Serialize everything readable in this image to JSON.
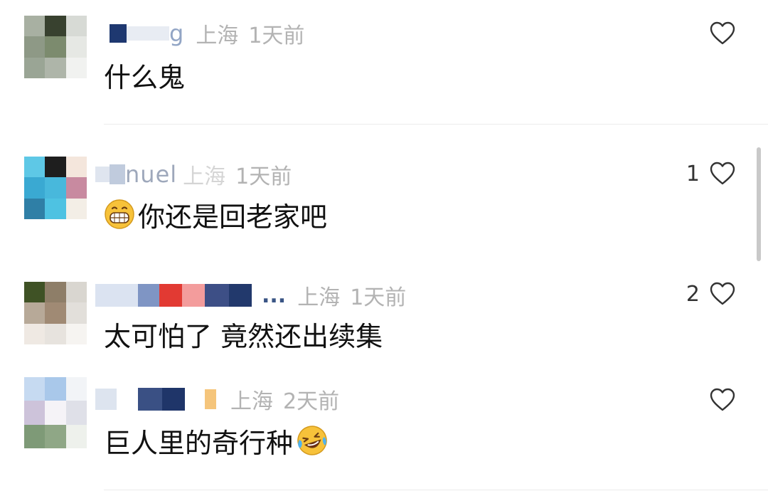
{
  "comments": [
    {
      "name_visible": "g",
      "location": "上海",
      "time": "1天前",
      "text": "什么鬼",
      "likes": ""
    },
    {
      "name_visible": "nuel",
      "location": "上海",
      "time": "1天前",
      "text": "你还是回老家吧",
      "likes": "1"
    },
    {
      "name_visible": "...",
      "location": "上海",
      "time": "1天前",
      "text": "太可怕了 竟然还出续集",
      "likes": "2"
    },
    {
      "name_visible": "",
      "location": "上海",
      "time": "2天前",
      "text": "巨人里的奇行种",
      "likes": ""
    }
  ],
  "icons": {
    "like": "heart-outline-icon",
    "grin_emoji": "grinning-face-icon",
    "laugh_emoji": "rolling-laughing-face-icon"
  },
  "colors": {
    "meta_gray": "#b3b3b3",
    "text": "#111111",
    "heart_stroke": "#333333"
  }
}
